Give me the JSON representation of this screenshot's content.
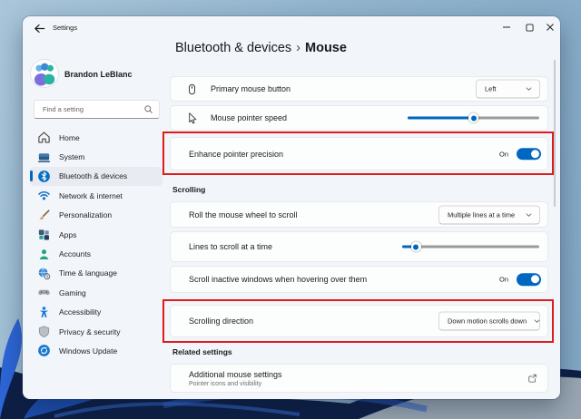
{
  "colors": {
    "accent": "#0067C0",
    "highlight": "#DE1C1C"
  },
  "titlebar": {
    "title": "Settings"
  },
  "sidebar": {
    "user": {
      "name": "Brandon LeBlanc"
    },
    "search": {
      "placeholder": "Find a setting"
    },
    "items": [
      {
        "label": "Home"
      },
      {
        "label": "System"
      },
      {
        "label": "Bluetooth & devices",
        "active": true
      },
      {
        "label": "Network & internet"
      },
      {
        "label": "Personalization"
      },
      {
        "label": "Apps"
      },
      {
        "label": "Accounts"
      },
      {
        "label": "Time & language"
      },
      {
        "label": "Gaming"
      },
      {
        "label": "Accessibility"
      },
      {
        "label": "Privacy & security"
      },
      {
        "label": "Windows Update"
      }
    ]
  },
  "breadcrumb": {
    "root": "Bluetooth & devices",
    "separator": "›",
    "current": "Mouse"
  },
  "sections": {
    "scrolling": "Scrolling",
    "related_settings": "Related settings"
  },
  "rows": {
    "primary_button": {
      "label": "Primary mouse button",
      "value": "Left"
    },
    "pointer_speed": {
      "label": "Mouse pointer speed",
      "percent": 50
    },
    "enhance_precision": {
      "label": "Enhance pointer precision",
      "state": "On"
    },
    "wheel_scroll": {
      "label": "Roll the mouse wheel to scroll",
      "value": "Multiple lines at a time"
    },
    "lines_to_scroll": {
      "label": "Lines to scroll at a time",
      "percent": 10
    },
    "scroll_inactive": {
      "label": "Scroll inactive windows when hovering over them",
      "state": "On"
    },
    "scroll_direction": {
      "label": "Scrolling direction",
      "value": "Down motion scrolls down"
    },
    "additional": {
      "label": "Additional mouse settings",
      "sublabel": "Pointer icons and visibility"
    }
  }
}
